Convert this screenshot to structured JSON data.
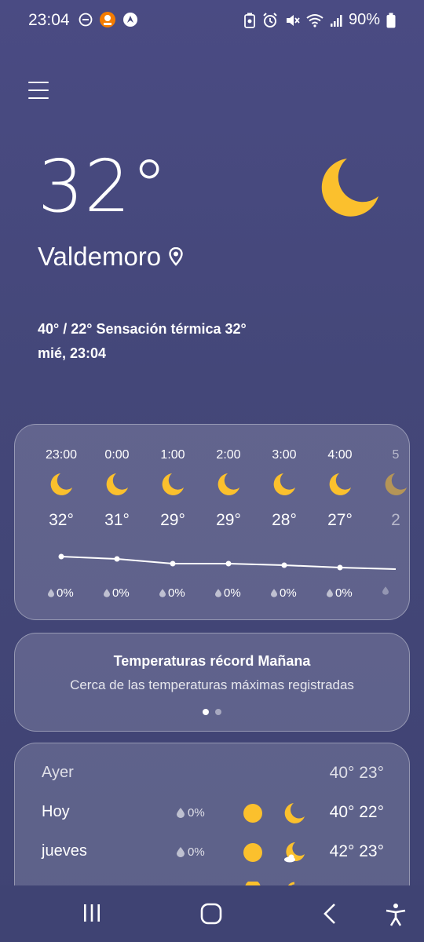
{
  "status_bar": {
    "time": "23:04",
    "battery": "90%",
    "left_icons": [
      "do-not-disturb-icon",
      "app-notification-icon",
      "navigation-icon"
    ],
    "right_icons": [
      "battery-saver-icon",
      "alarm-icon",
      "mute-icon",
      "wifi-icon",
      "signal-icon",
      "battery-icon"
    ]
  },
  "current": {
    "temperature": "32°",
    "location": "Valdemoro",
    "summary": "40° / 22° Sensación térmica 32°",
    "datetime": "mié, 23:04",
    "icon": "moon-icon"
  },
  "hourly": [
    {
      "time": "23:00",
      "temp": "32°",
      "rain": "0%",
      "icon": "moon-icon"
    },
    {
      "time": "0:00",
      "temp": "31°",
      "rain": "0%",
      "icon": "moon-icon"
    },
    {
      "time": "1:00",
      "temp": "29°",
      "rain": "0%",
      "icon": "moon-icon"
    },
    {
      "time": "2:00",
      "temp": "29°",
      "rain": "0%",
      "icon": "moon-icon"
    },
    {
      "time": "3:00",
      "temp": "28°",
      "rain": "0%",
      "icon": "moon-icon"
    },
    {
      "time": "4:00",
      "temp": "27°",
      "rain": "0%",
      "icon": "moon-icon"
    },
    {
      "time": "5",
      "temp": "2",
      "rain": "",
      "icon": "moon-icon"
    }
  ],
  "record": {
    "title": "Temperaturas récord Mañana",
    "subtitle": "Cerca de las temperaturas máximas registradas"
  },
  "daily": [
    {
      "day": "Ayer",
      "rain": "",
      "temps": "40° 23°"
    },
    {
      "day": "Hoy",
      "rain": "0%",
      "temps": "40° 22°"
    },
    {
      "day": "jueves",
      "rain": "0%",
      "temps": "42° 23°"
    }
  ],
  "colors": {
    "background": "#46497e",
    "icon_yellow": "#fbc02d",
    "card": "rgba(255,255,255,0.16)"
  }
}
